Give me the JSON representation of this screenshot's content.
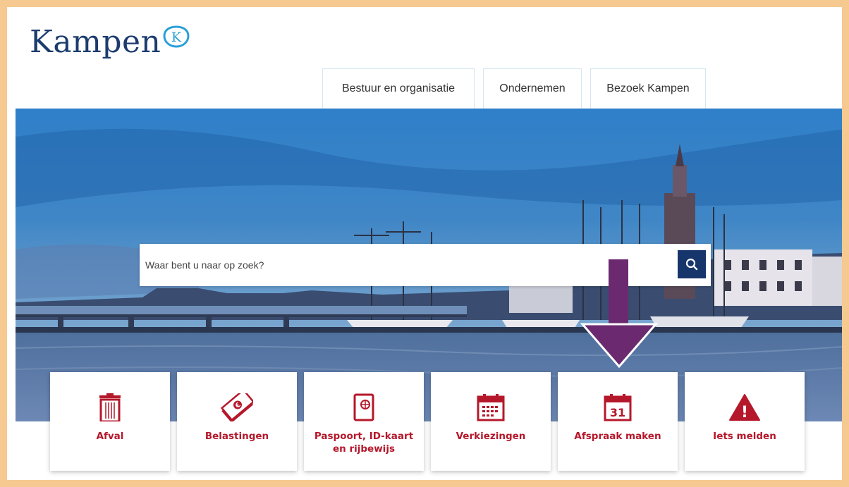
{
  "brand": {
    "name": "Kampen",
    "badge_letter": "K"
  },
  "nav": {
    "tabs": [
      {
        "label": "Bestuur en organisatie"
      },
      {
        "label": "Ondernemen"
      },
      {
        "label": "Bezoek Kampen"
      }
    ]
  },
  "search": {
    "placeholder": "Waar bent u naar op zoek?",
    "button_icon": "search-icon"
  },
  "tiles": [
    {
      "label": "Afval",
      "icon": "trash-icon"
    },
    {
      "label": "Belastingen",
      "icon": "money-icon"
    },
    {
      "label": "Paspoort, ID-kaart\nen rijbewijs",
      "icon": "passport-icon"
    },
    {
      "label": "Verkiezingen",
      "icon": "calendar-grid-icon"
    },
    {
      "label": "Afspraak maken",
      "icon": "calendar-31-icon",
      "icon_text": "31"
    },
    {
      "label": "Iets melden",
      "icon": "warning-icon",
      "icon_text": "!"
    }
  ],
  "colors": {
    "brand_blue": "#1c3c6f",
    "accent_red": "#b5182b",
    "search_button": "#16356a",
    "annotation_arrow": "#6b2a6f",
    "frame": "#f5c98f"
  }
}
